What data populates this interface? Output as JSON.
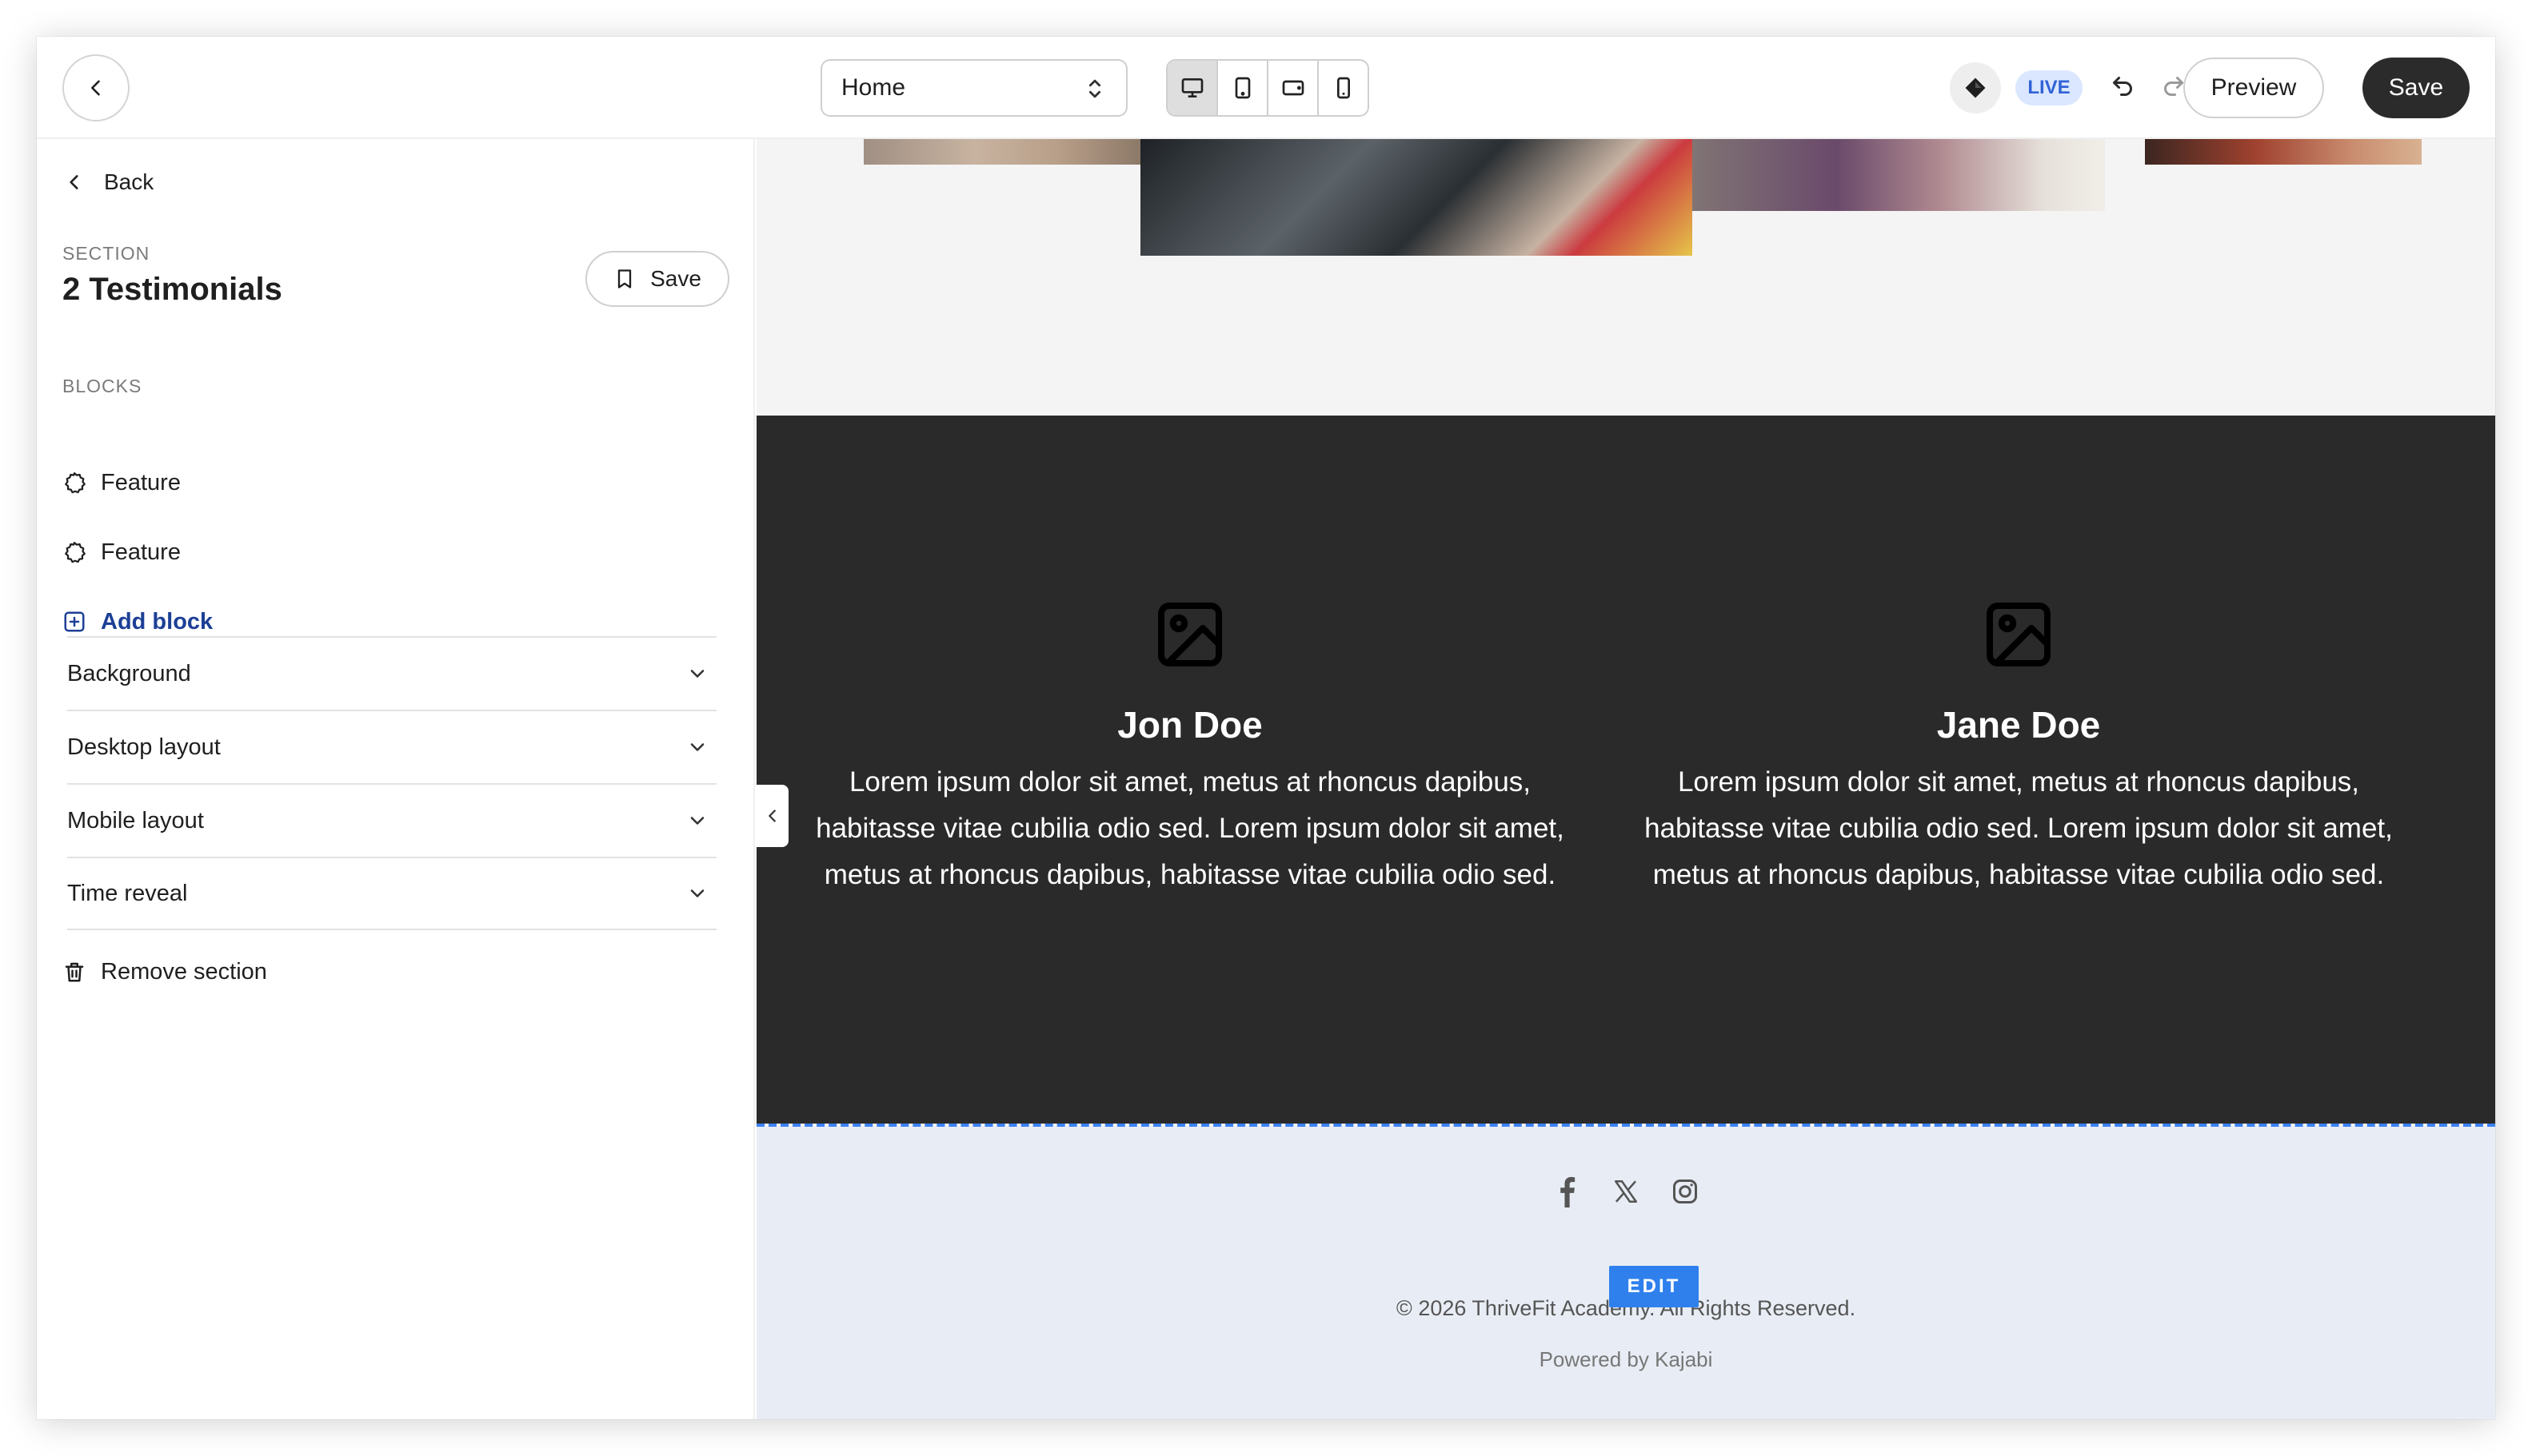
{
  "topbar": {
    "page_select_value": "Home",
    "live_label": "LIVE",
    "preview_label": "Preview",
    "save_label": "Save"
  },
  "sidebar": {
    "back_label": "Back",
    "section_eyebrow": "SECTION",
    "section_title": "2 Testimonials",
    "section_save_label": "Save",
    "blocks_eyebrow": "BLOCKS",
    "blocks": [
      {
        "label": "Feature"
      },
      {
        "label": "Feature"
      }
    ],
    "add_block_label": "Add block",
    "accordions": [
      {
        "label": "Background"
      },
      {
        "label": "Desktop layout"
      },
      {
        "label": "Mobile layout"
      },
      {
        "label": "Time reveal"
      }
    ],
    "remove_label": "Remove section"
  },
  "canvas": {
    "testimonials": [
      {
        "name": "Jon Doe",
        "body": "Lorem ipsum dolor sit amet, metus at rhoncus dapibus, habitasse vitae cubilia odio sed. Lorem ipsum dolor sit amet, metus at rhoncus dapibus, habitasse vitae cubilia odio sed."
      },
      {
        "name": "Jane Doe",
        "body": "Lorem ipsum dolor sit amet, metus at rhoncus dapibus, habitasse vitae cubilia odio sed. Lorem ipsum dolor sit amet, metus at rhoncus dapibus, habitasse vitae cubilia odio sed."
      }
    ],
    "footer": {
      "copyright": "© 2026 ThriveFit Academy. All Rights Reserved.",
      "powered_by": "Powered by Kajabi",
      "edit_label": "EDIT",
      "socials": [
        "facebook-icon",
        "x-icon",
        "instagram-icon"
      ]
    }
  },
  "colors": {
    "accent_blue": "#3b82f6",
    "dark_section": "#2a2a2a",
    "footer_bg": "#e8edf5",
    "live_badge_bg": "#dbe7ff",
    "add_block_text": "#1d3f96"
  }
}
